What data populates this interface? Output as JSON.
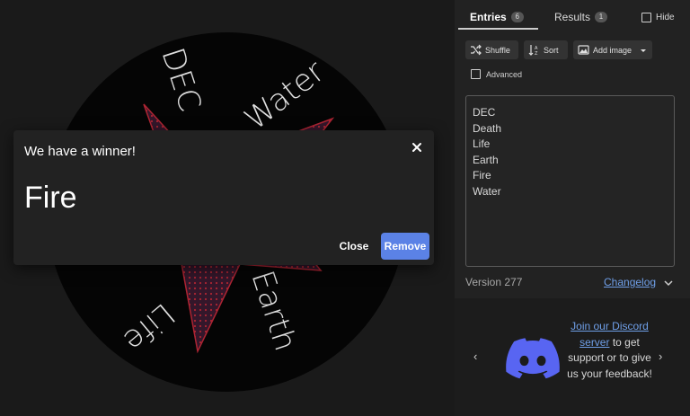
{
  "wheel": {
    "labels": [
      "DEC",
      "Water",
      "Earth",
      "Life"
    ],
    "colors": {
      "disc": "#050505",
      "star": "#5a2028",
      "star_edge": "#c02838",
      "label": "#e0e0e0"
    }
  },
  "dialog": {
    "title": "We have a winner!",
    "winner": "Fire",
    "close_label": "Close",
    "remove_label": "Remove",
    "close_icon": "close-icon"
  },
  "sidebar": {
    "tabs": [
      {
        "label": "Entries",
        "count": "6"
      },
      {
        "label": "Results",
        "count": "1"
      }
    ],
    "hide_label": "Hide",
    "toolbar": {
      "shuffle_label": "Shuffle",
      "sort_label": "Sort",
      "add_image_label": "Add image"
    },
    "advanced_label": "Advanced",
    "entries": [
      "DEC",
      "Death",
      "Life",
      "Earth",
      "Fire",
      "Water"
    ],
    "version": "Version 277",
    "changelog_label": "Changelog",
    "discord": {
      "link_text": "Join our Discord server",
      "body_text": "to get support or to give us your feedback!",
      "prev": "‹",
      "next": "›"
    }
  },
  "colors": {
    "accent": "#5b82e6",
    "link": "#6f9fe8",
    "discord": "#5865f2",
    "sidebar_bg": "#222222",
    "page_bg": "#1a1a1a"
  }
}
